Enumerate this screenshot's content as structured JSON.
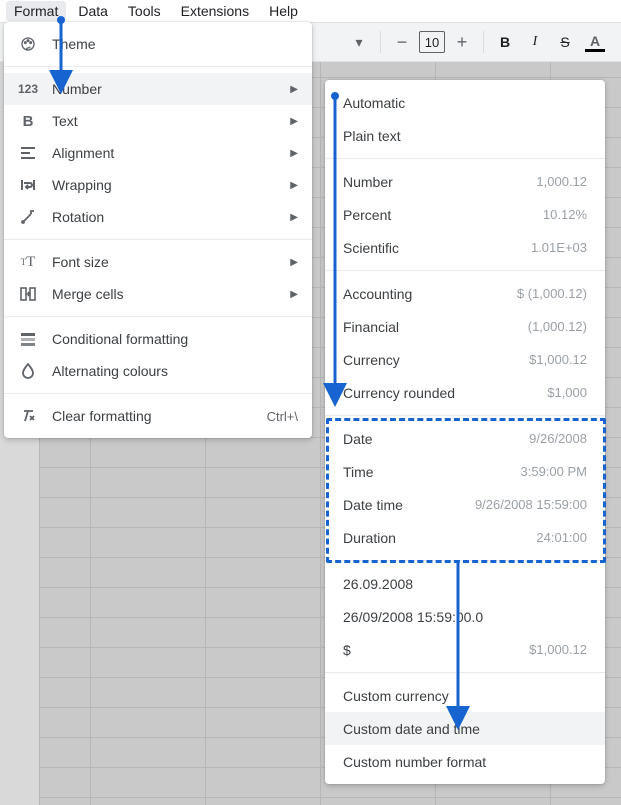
{
  "menubar": {
    "format": "Format",
    "data": "Data",
    "tools": "Tools",
    "extensions": "Extensions",
    "help": "Help"
  },
  "toolbar": {
    "font_size": "10"
  },
  "format_menu": {
    "theme": "Theme",
    "number": "Number",
    "text": "Text",
    "alignment": "Alignment",
    "wrapping": "Wrapping",
    "rotation": "Rotation",
    "font_size": "Font size",
    "merge_cells": "Merge cells",
    "conditional": "Conditional formatting",
    "alternating": "Alternating colours",
    "clear": "Clear formatting",
    "clear_shortcut": "Ctrl+\\"
  },
  "number_menu": {
    "automatic": "Automatic",
    "plain_text": "Plain text",
    "number_l": "Number",
    "number_v": "1,000.12",
    "percent_l": "Percent",
    "percent_v": "10.12%",
    "scientific_l": "Scientific",
    "scientific_v": "1.01E+03",
    "accounting_l": "Accounting",
    "accounting_v": "$ (1,000.12)",
    "financial_l": "Financial",
    "financial_v": "(1,000.12)",
    "currency_l": "Currency",
    "currency_v": "$1,000.12",
    "currency_r_l": "Currency rounded",
    "currency_r_v": "$1,000",
    "date_l": "Date",
    "date_v": "9/26/2008",
    "time_l": "Time",
    "time_v": "3:59:00 PM",
    "datetime_l": "Date time",
    "datetime_v": "9/26/2008 15:59:00",
    "duration_l": "Duration",
    "duration_v": "24:01:00",
    "locale_date": "26.09.2008",
    "locale_datetime": "26/09/2008 15:59:00.0",
    "locale_currency_l": "$",
    "locale_currency_v": "$1,000.12",
    "custom_currency": "Custom currency",
    "custom_datetime": "Custom date and time",
    "custom_number": "Custom number format"
  }
}
